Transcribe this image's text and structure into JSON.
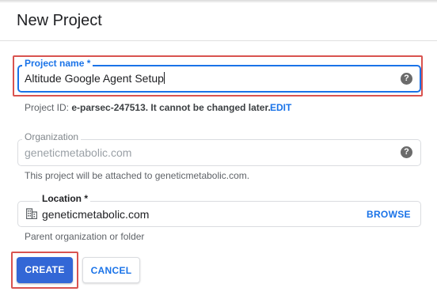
{
  "dialog": {
    "title": "New Project"
  },
  "project_name": {
    "label": "Project name *",
    "value": "Altitude Google Agent Setup",
    "help_icon": "help-circle-icon",
    "id_prefix": "Project ID: ",
    "id_value": "e-parsec-247513",
    "id_suffix": ". It cannot be changed later.",
    "edit_label": "EDIT"
  },
  "organization": {
    "label": "Organization",
    "value": "geneticmetabolic.com",
    "help_icon": "help-circle-icon",
    "hint": "This project will be attached to geneticmetabolic.com."
  },
  "location": {
    "label": "Location *",
    "icon": "building-icon",
    "value": "geneticmetabolic.com",
    "browse_label": "BROWSE",
    "hint": "Parent organization or folder"
  },
  "actions": {
    "create_label": "CREATE",
    "cancel_label": "CANCEL"
  },
  "colors": {
    "accent": "#1a73e8",
    "primary_button": "#3367d6",
    "highlight": "#d9534f"
  }
}
